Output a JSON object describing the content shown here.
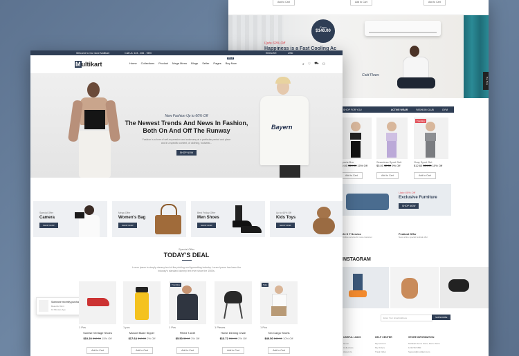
{
  "topbar": {
    "welcome": "Welcome to Our store Multikart",
    "phone": "Call Us: 123 - 456 - 7890",
    "language": "ENGLISH",
    "currency": "USD"
  },
  "header": {
    "logo_m": "M",
    "logo_rest": "ultikart",
    "nav": [
      "Home",
      "Collections",
      "Product",
      "Mega Menu",
      "Blogs",
      "Seller",
      "Pages"
    ],
    "buy_now": "Buy Now",
    "buy_badge": "50% off"
  },
  "hero": {
    "tag": "New Fashion Up to 60% Off",
    "title": "The Newest Trends And News In Fashion, Both On And Off The Runway",
    "desc": "Fashion is a form of self-expression and autonomy at a particular period and place and in a specific context, of clothing, footwear...",
    "button": "SHOP NOW",
    "shirt": "Bayern"
  },
  "categories": [
    {
      "tag": "Special Offer",
      "title": "Camera",
      "button": "SHOP NOW"
    },
    {
      "tag": "Mega Offer",
      "title": "Women's Bag",
      "button": "SHOP NOW"
    },
    {
      "tag": "Best Friday Offer",
      "title": "Men Shoes",
      "button": "SHOP NOW"
    },
    {
      "tag": "Up to 60% Off",
      "title": "Kids Toys",
      "button": "SHOP NOW"
    }
  ],
  "deal": {
    "tag": "Special Offer",
    "title": "TODAY'S DEAL",
    "desc": "Lorem Ipsum is simply dummy text of the printing and typesetting industry. Lorem Ipsum has been the industry's standard dummy text ever since the 1500s."
  },
  "notification": {
    "title": "Someone recently purchase the item",
    "sub": "Beautiful Shirt",
    "time": "10 Minutes Ago"
  },
  "deal_products": [
    {
      "stock": "1 Pcs",
      "name": "Sunrise Ventage Shoes",
      "price": "$10.20",
      "old": "$12.00",
      "off": "15% Off",
      "badge": "",
      "button": "Add to Cart"
    },
    {
      "stock": "1 pcs",
      "name": "Muscle Blaze Sipper",
      "price": "$17.64",
      "old": "$18.00",
      "off": "2% Off",
      "badge": "",
      "button": "Add to Cart"
    },
    {
      "stock": "1 Pcs",
      "name": "Fitted T-shirt",
      "price": "$5.50",
      "old": "$5.67",
      "off": "3% Off",
      "badge": "Trending",
      "button": "Add to Cart"
    },
    {
      "stock": "1 Pieces",
      "name": "Home Dinning Chair",
      "price": "$13.72",
      "old": "$14.00",
      "off": "2% Off",
      "badge": "",
      "button": "Add to Cart"
    },
    {
      "stock": "1 Pcs",
      "name": "Tan Cargo Shorts",
      "price": "$40.50",
      "old": "$45.00",
      "off": "10% Off",
      "badge": "Sale",
      "button": "Add to Cart"
    }
  ],
  "back": {
    "top_buttons": [
      "Add to Cart",
      "Add to Cart",
      "Add to Cart"
    ],
    "ac": {
      "circle_top": "From",
      "circle_price": "$140.00",
      "tag": "Upto 60% Off",
      "title": "Happiness is a Fast Cooling Ac",
      "cold": "Cold Flows",
      "side_tab": "Buy Now"
    },
    "tabs": {
      "left": "SHOP FOR YOU",
      "active": "ACTIVE WEAR",
      "other": "FASHION CLUB",
      "last": "GYM"
    },
    "products": [
      {
        "name": "Sports Bra",
        "price": "$9.00",
        "old": "$10.00",
        "off": "10% Off",
        "button": "Add to Cart",
        "badge": ""
      },
      {
        "name": "Seamless Sport Suit",
        "price": "$5.00",
        "old": "$5.50",
        "off": "9% Off",
        "button": "Add to Cart",
        "badge": ""
      },
      {
        "name": "Gray Sport Set",
        "price": "$12.60",
        "old": "$14.00",
        "off": "10% Off",
        "button": "Add to Cart",
        "badge": "Trending"
      }
    ],
    "furniture": {
      "tag": "Upto 60% Off",
      "title": "Exclusive Furniture",
      "button": "SHOP NOW"
    },
    "services": [
      {
        "title": "24 X 7 Service",
        "desc": "Online service for new customer"
      },
      {
        "title": "Festival Offer",
        "desc": "New online special festival offer"
      }
    ],
    "instagram": "INSTAGRAM",
    "newsletter": {
      "placeholder": "Enter Your Email Address",
      "button": "SUBSCRIBE"
    },
    "footer": {
      "cols": [
        "USEFUL LINKS",
        "HELP CENTER",
        "STORE INFORMATION"
      ],
      "links1": [
        "Home",
        "Collections",
        "About Us"
      ],
      "links2": [
        "My Account",
        "My Orders",
        "Track Order"
      ],
      "info": [
        "Multikart Demo Store, Demo Store",
        "1234 567 890",
        "Support@multikart.com"
      ]
    }
  },
  "colors": {
    "navy": "#2f3e55",
    "accent": "#e2545d",
    "background": "#6a809c"
  }
}
